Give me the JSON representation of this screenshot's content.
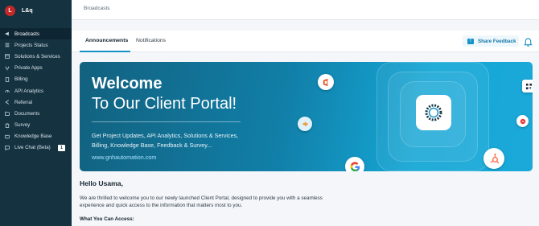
{
  "brand": {
    "initial": "L",
    "name": "L&q"
  },
  "sidebar": {
    "items": [
      {
        "label": "Broadcasts",
        "icon": "megaphone-icon",
        "active": true
      },
      {
        "label": "Projects Status",
        "icon": "list-icon"
      },
      {
        "label": "Solutions & Services",
        "icon": "grid-icon"
      },
      {
        "label": "Private Apps",
        "icon": "fork-icon"
      },
      {
        "label": "Billing",
        "icon": "receipt-icon"
      },
      {
        "label": "API Analytics",
        "icon": "gauge-icon"
      },
      {
        "label": "Referral",
        "icon": "share-icon"
      },
      {
        "label": "Documents",
        "icon": "folder-icon"
      },
      {
        "label": "Survey",
        "icon": "clipboard-icon"
      },
      {
        "label": "Knowledge Base",
        "icon": "book-icon"
      },
      {
        "label": "Live Chat (Beta)",
        "icon": "chat-icon",
        "badge": "1"
      }
    ]
  },
  "topbar": {
    "breadcrumb": "Broadcasts"
  },
  "tabs": {
    "items": [
      {
        "label": "Announcements",
        "active": true
      },
      {
        "label": "Notifications"
      }
    ],
    "share_label": "Share Feedback"
  },
  "banner": {
    "title_line1": "Welcome",
    "title_line2": "To Our Client Portal!",
    "text": "Get Project Updates, API Analytics, Solutions & Services, Billing, Knowledge Base, Feedback & Survey...",
    "link": "www.gnhautomation.com"
  },
  "content": {
    "greeting": "Hello Usama,",
    "intro": "We are thrilled to welcome you to our newly launched Client Portal, designed to provide you with a seamless experience and quick access to the information that matters most to you.",
    "access_heading": "What You Can Access:"
  },
  "colors": {
    "sidebar": "#153240",
    "accent": "#1592c8",
    "banner_start": "#12617f",
    "banner_end": "#1ba9d9"
  }
}
